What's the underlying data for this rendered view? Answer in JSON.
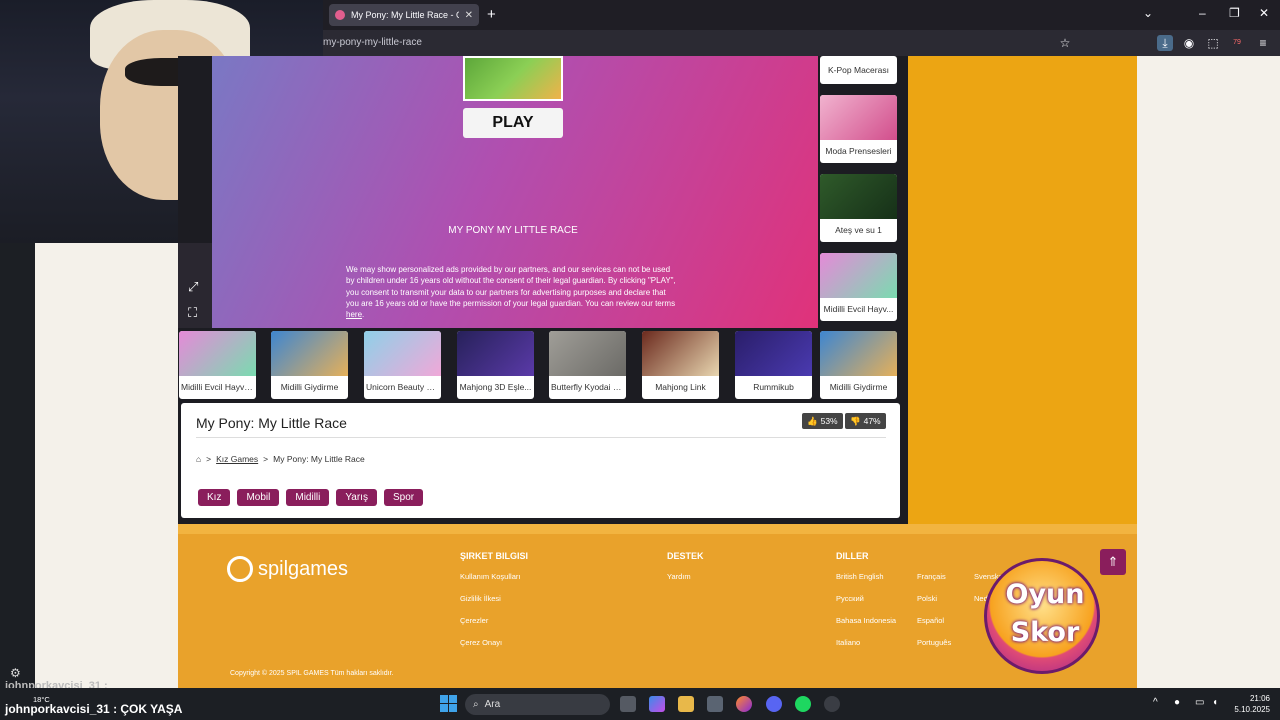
{
  "browser": {
    "tab_title": "My Pony: My Little Race - Oyun",
    "url": "my-pony-my-little-race",
    "new_tab": "+",
    "extension_badge": "79"
  },
  "game": {
    "play_label": "PLAY",
    "title_caps": "MY PONY MY LITTLE RACE",
    "disclaimer": "We may show personalized ads provided by our partners, and our services can not be used by children under 16 years old without the consent of their legal guardian. By clicking \"PLAY\", you consent to transmit your data to our partners for advertising purposes and declare that you are 16 years old or have the permission of your legal guardian. You can review our terms",
    "disclaimer_link": "here"
  },
  "sidebar_games": [
    {
      "label": "K-Pop Macerası",
      "color": "#3a3a4a"
    },
    {
      "label": "Moda Prensesleri",
      "color": "#e8a0c0"
    },
    {
      "label": "Ateş ve su 1",
      "color": "#2f5a2a"
    },
    {
      "label": "Midilli Evcil Hayv...",
      "color": "#c77ad8"
    }
  ],
  "related_games": [
    {
      "label": "Midilli Evcil Hayva...",
      "color": "#c77ad8"
    },
    {
      "label": "Midilli Giydirme",
      "color": "#4a9ad8"
    },
    {
      "label": "Unicorn Beauty S...",
      "color": "#8fd0e8"
    },
    {
      "label": "Mahjong 3D Eşle...",
      "color": "#27215a"
    },
    {
      "label": "Butterfly Kyodai C...",
      "color": "#8b8a88"
    },
    {
      "label": "Mahjong Link",
      "color": "#6b2a1e"
    },
    {
      "label": "Rummikub",
      "color": "#2a1e6a"
    },
    {
      "label": "Midilli Giydirme",
      "color": "#4a9ad8"
    }
  ],
  "info": {
    "title": "My Pony: My Little Race",
    "likes": "53%",
    "dislikes": "47%",
    "breadcrumb_category": "Kız Games",
    "breadcrumb_current": "My Pony: My Little Race",
    "tags": [
      "Kız",
      "Mobil",
      "Midilli",
      "Yarış",
      "Spor"
    ]
  },
  "footer": {
    "logo": "spilgames",
    "company_heading": "ŞIRKET BILGISI",
    "company_links": [
      "Kullanım Koşulları",
      "Gizlilik İlkesi",
      "Çerezler",
      "Çerez Onayı"
    ],
    "support_heading": "DESTEK",
    "support_links": [
      "Yardım"
    ],
    "languages_heading": "DILLER",
    "languages_col1": [
      "British English",
      "Русский",
      "Bahasa Indonesia",
      "Italiano"
    ],
    "languages_col2": [
      "Français",
      "Polski",
      "Español",
      "Português"
    ],
    "languages_col3": [
      "Svenska",
      "Neder..."
    ],
    "copyright": "Copyright © 2025 SPIL GAMES Tüm hakları saklıdır."
  },
  "watermark": {
    "line1": "Oyun",
    "line2": "Skor"
  },
  "chat": {
    "line1": "johnporkavcisi_31 :",
    "line2_user": "johnporkavcisi_31",
    "line2_text": ": ÇOK YAŞA"
  },
  "taskbar": {
    "search_placeholder": "Ara",
    "temperature": "18°C",
    "time": "21:06",
    "date": "5.10.2025"
  }
}
